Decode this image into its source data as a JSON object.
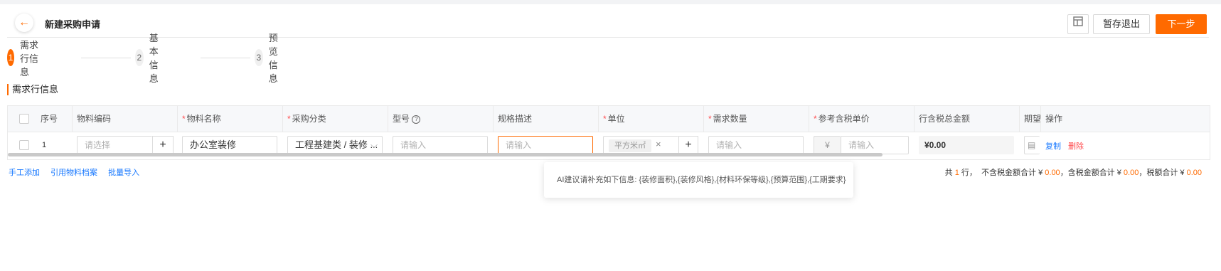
{
  "header": {
    "title": "新建采购申请",
    "draft_label": "暂存退出",
    "next_label": "下一步"
  },
  "steps": [
    {
      "num": "1",
      "label": "需求行信息"
    },
    {
      "num": "2",
      "label": "基本信息"
    },
    {
      "num": "3",
      "label": "预览信息"
    }
  ],
  "section_title": "需求行信息",
  "table": {
    "headers": {
      "seq": "序号",
      "material_code": "物料编码",
      "material_name": "物料名称",
      "category": "采购分类",
      "model": "型号",
      "spec": "规格描述",
      "unit": "单位",
      "quantity": "需求数量",
      "ref_price": "参考含税单价",
      "total": "行含税总金额",
      "expected": "期望交",
      "ops": "操作"
    },
    "row": {
      "seq": "1",
      "material_code_placeholder": "请选择",
      "material_name": "办公室装修",
      "category": "工程基建类 / 装修 ...",
      "model_placeholder": "请输入",
      "spec_placeholder": "请输入",
      "unit_tag": "平方米㎡",
      "quantity_placeholder": "请输入",
      "currency": "¥",
      "price_placeholder": "请输入",
      "total": "¥0.00",
      "copy": "复制",
      "delete": "删除"
    }
  },
  "bottom_links": [
    "手工添加",
    "引用物料档案",
    "批量导入"
  ],
  "summary": {
    "prefix": "共 ",
    "rows": "1",
    "rows_suffix": " 行，",
    "no_tax_label": "不含税金额合计 ¥ ",
    "no_tax": "0.00",
    "tax_label": "，含税金额合计 ¥ ",
    "tax": "0.00",
    "tax_amount_label": "，税额合计 ¥ ",
    "tax_amount": "0.00"
  },
  "tooltip": "AI建议请补充如下信息: {装修面积},{装修风格},{材料环保等级},{预算范围},{工期要求}",
  "colors": {
    "accent": "#ff6a00",
    "link": "#1677ff",
    "danger": "#ff4d4f"
  }
}
